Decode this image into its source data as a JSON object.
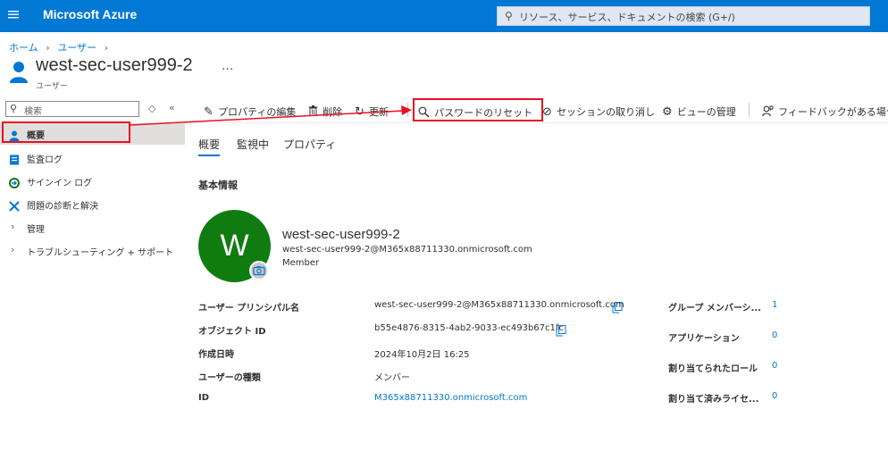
{
  "header": {
    "brand": "Microsoft Azure",
    "search_placeholder": "リソース、サービス、ドキュメントの検索 (G+/)"
  },
  "breadcrumb": {
    "items": [
      "ホーム",
      "ユーザー"
    ]
  },
  "page": {
    "title": "west-sec-user999-2",
    "more": "...",
    "subtitle": "ユーザー"
  },
  "sidebar": {
    "search_placeholder": "検索",
    "collapse": "«",
    "items": [
      {
        "label": "概要",
        "icon": "user-icon"
      },
      {
        "label": "監査ログ",
        "icon": "log-icon"
      },
      {
        "label": "サインイン ログ",
        "icon": "signin-icon"
      },
      {
        "label": "問題の診断と解決",
        "icon": "wrench-icon"
      },
      {
        "label": "管理",
        "icon": "chevron-right-icon"
      },
      {
        "label": "トラブルシューティング + サポート",
        "icon": "chevron-right-icon"
      }
    ]
  },
  "toolbar": {
    "edit": "プロパティの編集",
    "delete": "削除",
    "refresh": "更新",
    "reset_password": "パスワードのリセット",
    "revoke_sessions": "セッションの取り消し",
    "manage_view": "ビューの管理",
    "feedback": "フィードバックがある場合"
  },
  "tabs": [
    "概要",
    "監視中",
    "プロパティ"
  ],
  "content": {
    "heading": "基本情報",
    "avatar_initial": "W",
    "avatar_color": "#107c10",
    "name": "west-sec-user999-2",
    "upn": "west-sec-user999-2@M365x88711330.onmicrosoft.com",
    "user_type": "Member",
    "properties": [
      {
        "label": "ユーザー プリンシパル名",
        "value": "west-sec-user999-2@M365x88711330.onmicrosoft.com"
      },
      {
        "label": "オブジェクト ID",
        "value": "b55e4876-8315-4ab2-9033-ec493b67c1fc"
      },
      {
        "label": "作成日時",
        "value": "2024年10月2日 16:25"
      },
      {
        "label": "ユーザーの種類",
        "value": "メンバー"
      },
      {
        "label": "ID",
        "value": "M365x88711330.onmicrosoft.com"
      }
    ],
    "stats": [
      {
        "label": "グループ メンバーシ...",
        "value": "1"
      },
      {
        "label": "アプリケーション",
        "value": "0"
      },
      {
        "label": "割り当てられたロール",
        "value": "0"
      },
      {
        "label": "割り当て済みライセ...",
        "value": "0"
      }
    ]
  },
  "colors": {
    "azure_blue": "#0078d4",
    "highlight_red": "#e81123"
  }
}
